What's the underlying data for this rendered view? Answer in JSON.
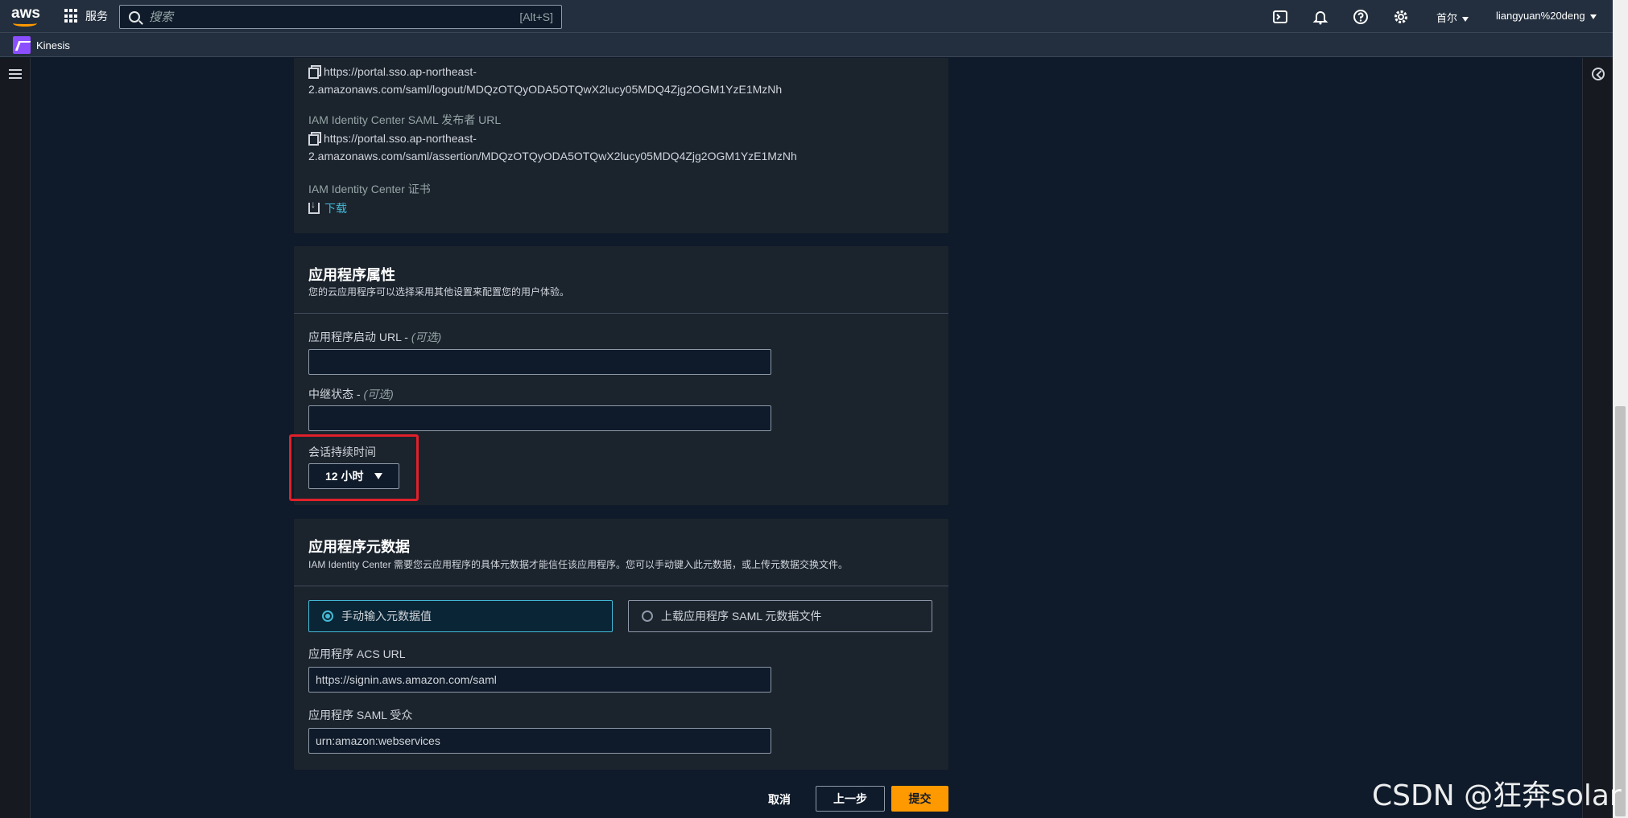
{
  "topbar": {
    "logo_text": "aws",
    "services_label": "服务",
    "search_placeholder": "搜索",
    "search_shortcut": "[Alt+S]",
    "region": "首尔",
    "user": "liangyuan%20deng"
  },
  "secbar": {
    "service_name": "Kinesis"
  },
  "idp_panel": {
    "logout_url_line1": "https://portal.sso.ap-northeast-",
    "logout_url_line2": "2.amazonaws.com/saml/logout/MDQzOTQyODA5OTQwX2lucy05MDQ4Zjg2OGM1YzE1MzNh",
    "issuer_label": "IAM Identity Center SAML 发布者 URL",
    "issuer_url_line1": "https://portal.sso.ap-northeast-",
    "issuer_url_line2": "2.amazonaws.com/saml/assertion/MDQzOTQyODA5OTQwX2lucy05MDQ4Zjg2OGM1YzE1MzNh",
    "cert_label": "IAM Identity Center 证书",
    "download_label": "下载"
  },
  "app_props": {
    "title": "应用程序属性",
    "description": "您的云应用程序可以选择采用其他设置来配置您的用户体验。",
    "start_url_label": "应用程序启动 URL -",
    "relay_label": "中继状态 -",
    "optional_label": "(可选)",
    "start_url_value": "",
    "relay_value": "",
    "session_label": "会话持续时间",
    "session_value": "12 小时"
  },
  "metadata": {
    "title": "应用程序元数据",
    "description": "IAM Identity Center 需要您云应用程序的具体元数据才能信任该应用程序。您可以手动键入此元数据，或上传元数据交换文件。",
    "option_manual": "手动输入元数据值",
    "option_upload": "上载应用程序 SAML 元数据文件",
    "acs_label": "应用程序 ACS URL",
    "acs_value": "https://signin.aws.amazon.com/saml",
    "audience_label": "应用程序 SAML 受众",
    "audience_value": "urn:amazon:webservices"
  },
  "footer": {
    "cancel": "取消",
    "previous": "上一步",
    "submit": "提交"
  },
  "watermark": "CSDN @狂奔solar",
  "colors": {
    "accent": "#ff9900",
    "link": "#44b9d6",
    "highlight": "#e0202a"
  }
}
